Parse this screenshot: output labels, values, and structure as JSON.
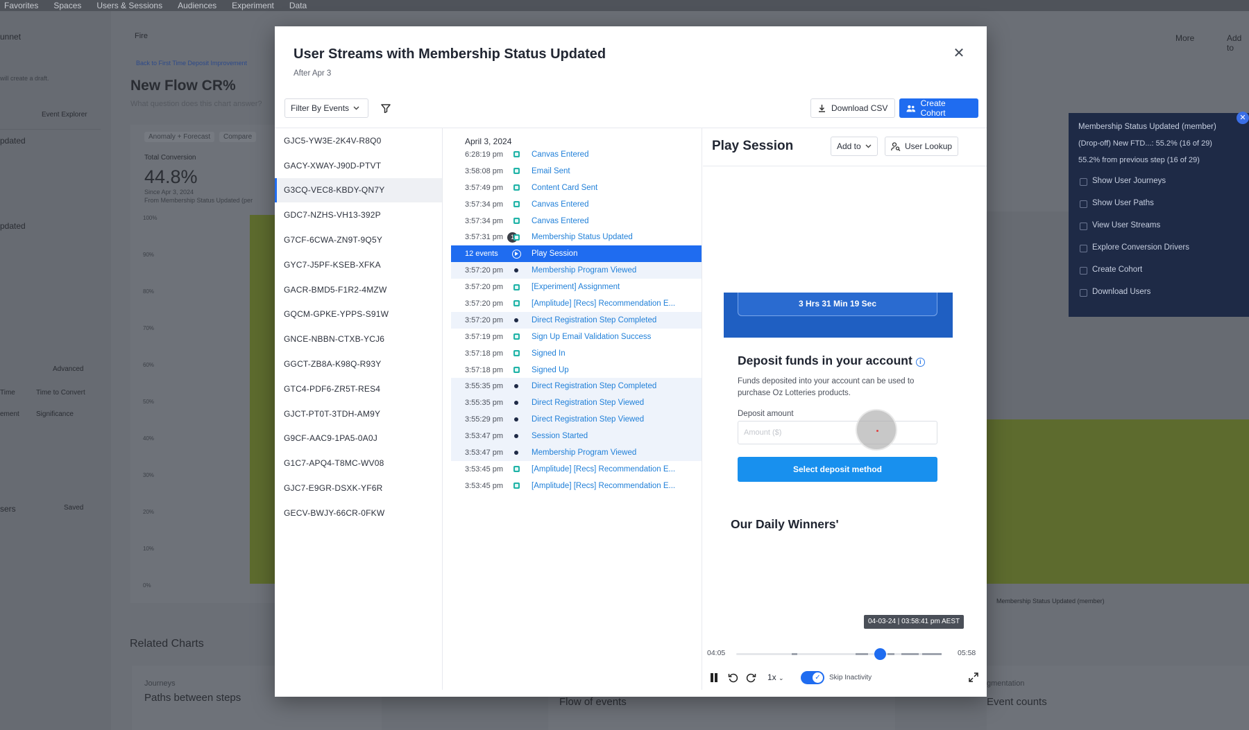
{
  "background": {
    "topnav": [
      "Favorites",
      "Spaces",
      "Users & Sessions",
      "Audiences",
      "Experiment",
      "Data"
    ],
    "left_rows": [
      "unnet",
      "will create a draft.",
      "Event Explorer",
      "pdated",
      "pdated",
      "Advanced",
      "Time",
      "Time to Convert",
      "ement",
      "Significance",
      "sers",
      "Saved"
    ],
    "breadcrumb": "Back to First Time Deposit Improvement",
    "flow_title": "New Flow CR%",
    "flow_sub": "What question does this chart answer?",
    "chips": [
      "Anomaly + Forecast",
      "Compare"
    ],
    "total_label": "Total Conversion",
    "total_value": "44.8%",
    "since": "Since Apr 3, 2024",
    "from": "From Membership Status Updated (per",
    "ticks": [
      "100%",
      "90%",
      "80%",
      "70%",
      "60%",
      "50%",
      "40%",
      "30%",
      "20%",
      "10%",
      "0%"
    ],
    "fire": "Fire",
    "more": "More",
    "addto": "Add to",
    "related": "Related Charts",
    "bottom_cards": [
      {
        "k": "Journeys",
        "v": "Paths between steps"
      },
      {
        "k": "",
        "v": "Flow of events"
      },
      {
        "k": "gmentation",
        "v": "Event counts"
      }
    ],
    "right_axis_label": "Membership Status Updated (member)"
  },
  "popover": {
    "title": "Membership Status Updated (member)",
    "line1": "(Drop-off) New FTD...: 55.2% (16 of 29)",
    "line2": "55.2% from previous step (16 of 29)",
    "items": [
      "Show User Journeys",
      "Show User Paths",
      "View User Streams",
      "Explore Conversion Drivers",
      "Create Cohort",
      "Download Users"
    ]
  },
  "modal": {
    "title": "User Streams with Membership Status Updated",
    "subtitle": "After Apr 3",
    "filter_label": "Filter By Events",
    "download_label": "Download CSV",
    "cohort_label": "Create Cohort"
  },
  "users": [
    "GJC5-YW3E-2K4V-R8Q0",
    "GACY-XWAY-J90D-PTVT",
    "G3CQ-VEC8-KBDY-QN7Y",
    "GDC7-NZHS-VH13-392P",
    "G7CF-6CWA-ZN9T-9Q5Y",
    "GYC7-J5PF-KSEB-XFKA",
    "GACR-BMD5-F1R2-4MZW",
    "GQCM-GPKE-YPPS-S91W",
    "GNCE-NBBN-CTXB-YCJ6",
    "GGCT-ZB8A-K98Q-R93Y",
    "GTC4-PDF6-ZR5T-RES4",
    "GJCT-PT0T-3TDH-AM9Y",
    "G9CF-AAC9-1PA5-0A0J",
    "G1C7-APQ4-T8MC-WV08",
    "GJC7-E9GR-DSXK-YF6R",
    "GECV-BWJY-66CR-0FKW"
  ],
  "stream": {
    "date": "April 3, 2024",
    "events": [
      {
        "time": "6:28:19 pm",
        "name": "Canvas Entered",
        "mark": "sq"
      },
      {
        "time": "3:58:08 pm",
        "name": "Email Sent",
        "mark": "sq"
      },
      {
        "time": "3:57:49 pm",
        "name": "Content Card Sent",
        "mark": "sq"
      },
      {
        "time": "3:57:34 pm",
        "name": "Canvas Entered",
        "mark": "sq"
      },
      {
        "time": "3:57:34 pm",
        "name": "Canvas Entered",
        "mark": "sq"
      },
      {
        "time": "3:57:31 pm",
        "name": "Membership Status Updated",
        "mark": "sq",
        "badge": "1"
      },
      {
        "time": "12 events",
        "name": "Play Session",
        "mark": "play",
        "active": true
      },
      {
        "time": "3:57:20 pm",
        "name": "Membership Program Viewed",
        "mark": "dot",
        "shade": true
      },
      {
        "time": "3:57:20 pm",
        "name": "[Experiment] Assignment",
        "mark": "sq"
      },
      {
        "time": "3:57:20 pm",
        "name": "[Amplitude] [Recs] Recommendation E...",
        "mark": "sq"
      },
      {
        "time": "3:57:20 pm",
        "name": "Direct Registration Step Completed",
        "mark": "dot",
        "shade": true
      },
      {
        "time": "3:57:19 pm",
        "name": "Sign Up Email Validation Success",
        "mark": "sq"
      },
      {
        "time": "3:57:18 pm",
        "name": "Signed In",
        "mark": "sq"
      },
      {
        "time": "3:57:18 pm",
        "name": "Signed Up",
        "mark": "sq"
      },
      {
        "time": "3:55:35 pm",
        "name": "Direct Registration Step Completed",
        "mark": "dot",
        "shade": true
      },
      {
        "time": "3:55:35 pm",
        "name": "Direct Registration Step Viewed",
        "mark": "dot",
        "shade": true
      },
      {
        "time": "3:55:29 pm",
        "name": "Direct Registration Step Viewed",
        "mark": "dot",
        "shade": true
      },
      {
        "time": "3:53:47 pm",
        "name": "Session Started",
        "mark": "dot",
        "shade": true
      },
      {
        "time": "3:53:47 pm",
        "name": "Membership Program Viewed",
        "mark": "dot",
        "shade": true
      },
      {
        "time": "3:53:45 pm",
        "name": "[Amplitude] [Recs] Recommendation E...",
        "mark": "sq"
      },
      {
        "time": "3:53:45 pm",
        "name": "[Amplitude] [Recs] Recommendation E...",
        "mark": "sq"
      }
    ]
  },
  "session": {
    "title": "Play Session",
    "addto_label": "Add to",
    "lookup_label": "User Lookup",
    "timer": "3 Hrs 31 Min 19 Sec",
    "deposit_title": "Deposit funds in your account",
    "deposit_desc": "Funds deposited into your account can be used to purchase Oz Lotteries products.",
    "amount_label": "Deposit amount",
    "amount_placeholder": "Amount ($)",
    "select_label": "Select deposit method",
    "winners": "Our Daily Winners'",
    "timestamp": "04-03-24 | 03:58:41 pm AEST",
    "time_start": "04:05",
    "time_end": "05:58",
    "progress": 0.7,
    "speed": "1x",
    "skip_label": "Skip Inactivity"
  },
  "colors": {
    "accent": "#1f6cf0",
    "link": "#1f7fd8",
    "event_square": "#1fb3a7",
    "deposit_button": "#1890ee",
    "banner": "#1f5fc2"
  }
}
